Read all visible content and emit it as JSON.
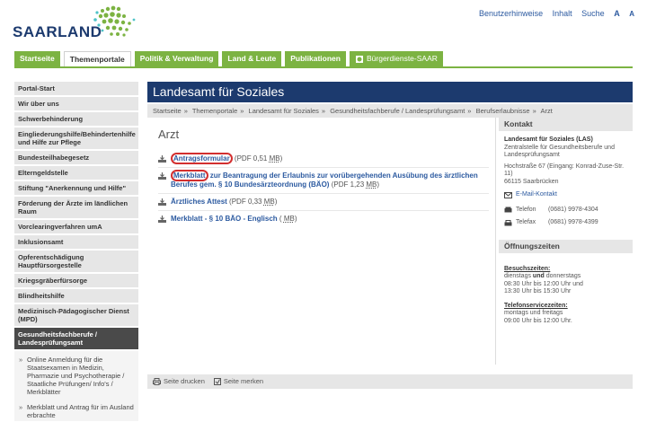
{
  "brand": {
    "logo_text": "SAARLAND"
  },
  "utility_links": [
    "Benutzerhinweise",
    "Inhalt",
    "Suche",
    "A",
    "A"
  ],
  "nav": {
    "items": [
      "Startseite",
      "Themenportale",
      "Politik & Verwaltung",
      "Land & Leute",
      "Publikationen"
    ],
    "saar_label": "Bürgerdienste-SAAR",
    "active_index": 1
  },
  "sidebar": {
    "items": [
      "Portal-Start",
      "Wir über uns",
      "Schwerbehinderung",
      "Eingliederungshilfe/Behindertenhilfe und Hilfe zur Pflege",
      "Bundesteilhabegesetz",
      "Elterngeldstelle",
      "Stiftung \"Anerkennung und Hilfe\"",
      "Förderung der Ärzte im ländlichen Raum",
      "Vorclearingverfahren umA",
      "Inklusionsamt",
      "Opferentschädigung Hauptfürsorgestelle",
      "Kriegsgräberfürsorge",
      "Blindheitshilfe",
      "Medizinisch-Pädagogischer Dienst (MPD)"
    ],
    "active": "Gesundheitsfachberufe / Landesprüfungsamt",
    "subitems": [
      "Online Anmeldung für die Staatsexamen in Medizin, Pharmazie und Psychotherapie / Staatliche Prüfungen/ Info's / Merkblätter",
      "Merkblatt und Antrag für im Ausland erbrachte"
    ]
  },
  "page": {
    "header": "Landesamt für Soziales",
    "breadcrumb": [
      "Startseite",
      "Themenportale",
      "Landesamt für Soziales",
      "Gesundheitsfachberufe / Landesprüfungsamt",
      "Berufserlaubnisse",
      "Arzt"
    ],
    "title": "Arzt"
  },
  "documents": [
    {
      "link": "Antragsformular",
      "link_rest": "",
      "meta_pre": " (PDF 0,51 ",
      "unit": "MB",
      "meta_post": ")"
    },
    {
      "link": "Merkblatt",
      "link_rest": " zur Beantragung der Erlaubnis zur vorübergehenden Ausübung des ärztlichen Berufes gem. § 10 Bundesärzteordnung (BÄO)",
      "meta_pre": " (PDF 1,23 ",
      "unit": "MB",
      "meta_post": ")"
    },
    {
      "link": "Ärztliches Attest",
      "link_rest": "",
      "meta_pre": " (PDF 0,33 ",
      "unit": "MB",
      "meta_post": ")"
    },
    {
      "link": "Merkblatt - § 10 BÄO - Englisch",
      "link_rest": "",
      "meta_pre": " ( ",
      "unit": "MB",
      "meta_post": ")"
    }
  ],
  "footer": {
    "print": "Seite drucken",
    "bookmark": "Seite merken"
  },
  "contact": {
    "heading": "Kontakt",
    "org": "Landesamt für Soziales (LAS)",
    "dept": "Zentralstelle für Gesundheitsberufe und Landesprüfungsamt",
    "address": "Hochstraße 67 (Eingang: Konrad-Zuse-Str. 11)",
    "city": "66115 Saarbrücken",
    "email": "E-Mail-Kontakt",
    "phone_label": "Telefon",
    "phone": "(0681) 9978-4304",
    "fax_label": "Telefax",
    "fax": "(0681) 9978-4399"
  },
  "hours": {
    "heading": "Öffnungszeiten",
    "visit_title": "Besuchszeiten:",
    "visit_line1_a": "dienstags ",
    "visit_line1_b": "und",
    "visit_line1_c": " donnerstags",
    "visit_line2": "08:30 Uhr bis 12:00 Uhr und",
    "visit_line3": "13:30 Uhr bis 15:30 Uhr",
    "phone_title": "Telefonservicezeiten:",
    "phone_line1": "montags und freitags",
    "phone_line2": "09:00 Uhr bis 12:00 Uhr."
  }
}
